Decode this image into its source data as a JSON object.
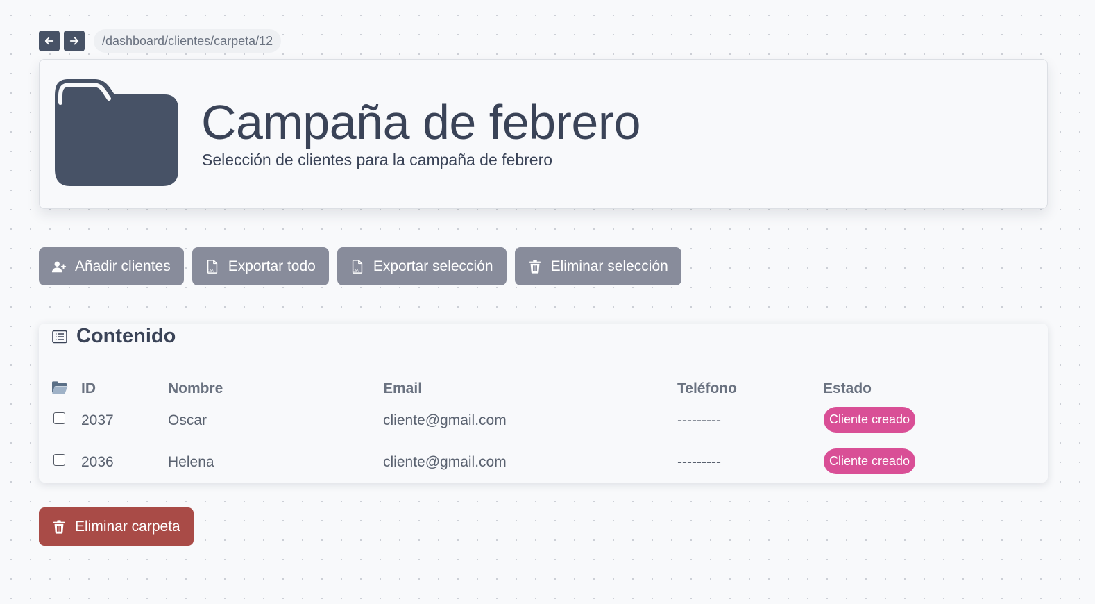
{
  "nav": {
    "path": "/dashboard/clientes/carpeta/12",
    "back_icon": "arrow-left-icon",
    "forward_icon": "arrow-right-icon"
  },
  "folder": {
    "icon": "folder-icon",
    "title": "Campaña de febrero",
    "subtitle": "Selección de clientes para la campaña de febrero"
  },
  "actions": [
    {
      "label": "Añadir clientes",
      "icon": "user-plus-icon"
    },
    {
      "label": "Exportar todo",
      "icon": "csv-file-icon"
    },
    {
      "label": "Exportar selección",
      "icon": "csv-file-icon"
    },
    {
      "label": "Eliminar selección",
      "icon": "trash-icon"
    }
  ],
  "content": {
    "title": "Contenido",
    "icon": "list-icon",
    "columns": [
      "ID",
      "Nombre",
      "Email",
      "Teléfono",
      "Estado"
    ],
    "select_icon": "open-folder-icon",
    "rows": [
      {
        "id": "2037",
        "nombre": "Oscar",
        "email": "cliente@gmail.com",
        "telefono": "---------",
        "estado": "Cliente creado"
      },
      {
        "id": "2036",
        "nombre": "Helena",
        "email": "cliente@gmail.com",
        "telefono": "---------",
        "estado": "Cliente creado"
      }
    ]
  },
  "delete_folder": {
    "label": "Eliminar carpeta",
    "icon": "trash-icon"
  },
  "colors": {
    "primary_dark": "#475266",
    "button_gray": "#888c9b",
    "badge_pink": "#d94f96",
    "danger_red": "#a94b47"
  }
}
